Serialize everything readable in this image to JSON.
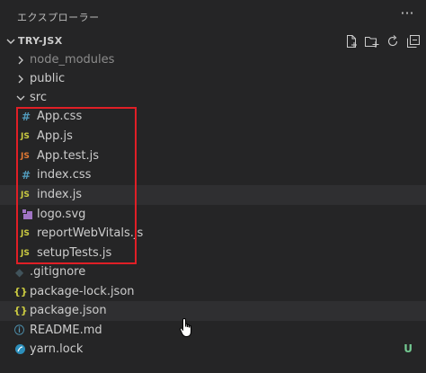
{
  "header": {
    "title": "エクスプローラー",
    "more_icon": "ellipsis-icon"
  },
  "section": {
    "title": "TRY-JSX",
    "actions": [
      "new-file-icon",
      "new-folder-icon",
      "refresh-icon",
      "collapse-all-icon"
    ]
  },
  "tree": [
    {
      "label": "node_modules",
      "kind": "folder",
      "expanded": false,
      "dim": true
    },
    {
      "label": "public",
      "kind": "folder",
      "expanded": false
    },
    {
      "label": "src",
      "kind": "folder",
      "expanded": true
    },
    {
      "label": "App.css",
      "kind": "css",
      "icon": "#"
    },
    {
      "label": "App.js",
      "kind": "js",
      "icon": "JS"
    },
    {
      "label": "App.test.js",
      "kind": "test",
      "icon": "JS"
    },
    {
      "label": "index.css",
      "kind": "css",
      "icon": "#"
    },
    {
      "label": "index.js",
      "kind": "js",
      "icon": "JS"
    },
    {
      "label": "logo.svg",
      "kind": "svg"
    },
    {
      "label": "reportWebVitals.js",
      "kind": "js",
      "icon": "JS"
    },
    {
      "label": "setupTests.js",
      "kind": "js",
      "icon": "JS"
    },
    {
      "label": ".gitignore",
      "kind": "git",
      "icon": "◆"
    },
    {
      "label": "package-lock.json",
      "kind": "json",
      "icon": "{}"
    },
    {
      "label": "package.json",
      "kind": "json",
      "icon": "{}"
    },
    {
      "label": "README.md",
      "kind": "info",
      "icon": "ⓘ"
    },
    {
      "label": "yarn.lock",
      "kind": "yarn",
      "status": "U"
    }
  ],
  "colors": {
    "background": "#252526",
    "highlight_box": "#e01f26",
    "git_untracked": "#73c991"
  }
}
